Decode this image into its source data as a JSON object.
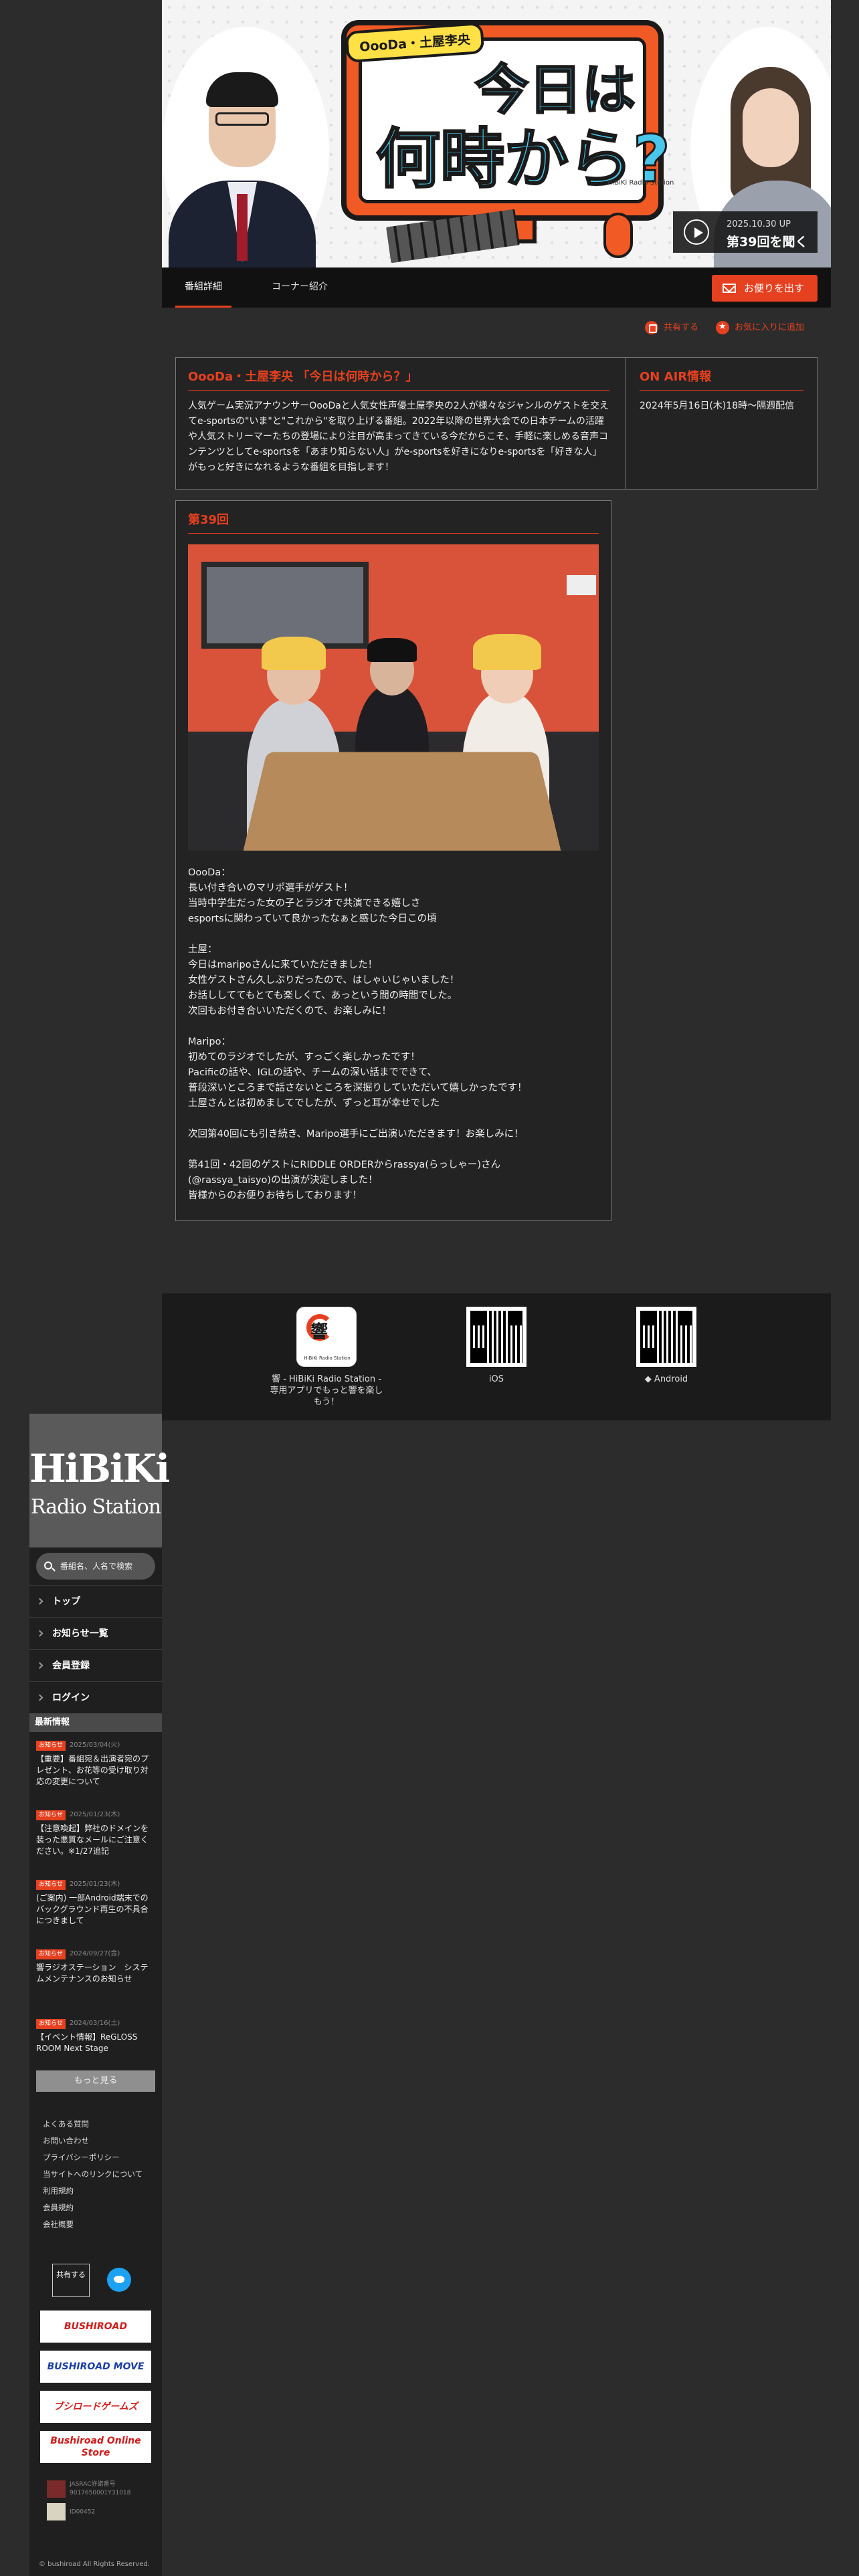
{
  "hero": {
    "logo_tag": "OooDa・土屋李央",
    "title_line1": "今日は",
    "title_line2": "何時から?",
    "brand_small": "HiBiKi Radio Station",
    "play_date": "2025.10.30 UP",
    "play_label": "第39回を聞く"
  },
  "tabs": [
    {
      "label": "番組詳細",
      "active": true
    },
    {
      "label": "コーナー紹介",
      "active": false
    }
  ],
  "letter_button": "お便りを出す",
  "share": {
    "share_label": "共有する",
    "favorite_label": "お気に入りに追加"
  },
  "info": {
    "title": "OooDa・土屋李央 「今日は何時から？」",
    "description": "人気ゲーム実況アナウンサーOooDaと人気女性声優土屋李央の2人が様々なジャンルのゲストを交えてe-sportsの\"いま\"と\"これから\"を取り上げる番組。2022年以降の世界大会での日本チームの活躍や人気ストリーマーたちの登場により注目が高まってきている今だからこそ、手軽に楽しめる音声コンテンツとしてe-sportsを「あまり知らない人」がe-sportsを好きになりe-sportsを「好きな人」がもっと好きになれるような番組を目指します！",
    "onair_title": "ON AIR情報",
    "onair_text": "2024年5月16日(木)18時〜隔週配信"
  },
  "episode": {
    "title": "第39回",
    "body": "OooDa：\n長い付き合いのマリポ選手がゲスト！\n当時中学生だった女の子とラジオで共演できる嬉しさ\nesportsに関わっていて良かったなぁと感じた今日この頃\n\n土屋：\n今日はmaripoさんに来ていただきました！\n女性ゲストさん久しぶりだったので、はしゃいじゃいました！\nお話ししててもとても楽しくて、あっという間の時間でした。\n次回もお付き合いいただくので、お楽しみに！\n\nMaripo：\n初めてのラジオでしたが、すっごく楽しかったです！\nPacificの話や、IGLの話や、チームの深い話までできて、\n普段深いところまで話さないところを深掘りしていただいて嬉しかったです！\n土屋さんとは初めましてでしたが、ずっと耳が幸せでした\n\n次回第40回にも引き続き、Maripo選手にご出演いただきます！お楽しみに！\n\n第41回・42回のゲストにRIDDLE ORDERからrassya(らっしゃー)さん\n(@rassya_taisyo)の出演が決定しました！\n皆様からのお便りお待ちしております！"
  },
  "apps": [
    {
      "caption": "響 - HiBiKi Radio Station - 専用アプリでもっと響を楽しもう！",
      "type": "logo",
      "logo_char": "響",
      "logo_sub": "HiBiKi Radio Station"
    },
    {
      "caption": " iOS",
      "type": "qr"
    },
    {
      "caption": "◆ Android",
      "type": "qr"
    }
  ],
  "sidebar": {
    "brand_line1": "HiBiKi",
    "brand_line2": "Radio Station",
    "search_placeholder": "番組名、人名で検索",
    "nav": [
      "トップ",
      "お知らせ一覧",
      "会員登録",
      "ログイン"
    ],
    "news_heading": "最新情報",
    "news": [
      {
        "badge": "お知らせ",
        "date": "2025/03/04(火)",
        "title": "【重要】番組宛＆出演者宛のプレゼント、お花等の受け取り対応の変更について"
      },
      {
        "badge": "お知らせ",
        "date": "2025/01/23(木)",
        "title": "【注意喚起】弊社のドメインを装った悪質なメールにご注意ください。※1/27追記"
      },
      {
        "badge": "お知らせ",
        "date": "2025/01/23(木)",
        "title": "(ご案内) 一部Android端末でのバックグラウンド再生の不具合につきまして"
      },
      {
        "badge": "お知らせ",
        "date": "2024/09/27(金)",
        "title": "響ラジオステーション　システムメンテナンスのお知らせ"
      },
      {
        "badge": "お知らせ",
        "date": "2024/03/16(土)",
        "title": "【イベント情報】ReGLOSS ROOM Next Stage"
      }
    ],
    "more_label": "もっと見る",
    "links": [
      "よくある質問",
      "お問い合わせ",
      "プライバシーポリシー",
      "当サイトへのリンクについて",
      "利用規約",
      "会員規約",
      "会社概要"
    ],
    "share_label": "共有する",
    "banners": [
      "BUSHIROAD",
      "BUSHIROAD MOVE",
      "ブシロードゲームズ",
      "Bushiroad Online Store"
    ],
    "license1": "JASRAC許諾番号\n9017650001Y31018",
    "license2": "ID00452",
    "copyright": "© bushiroad All Rights Reserved."
  },
  "colors": {
    "accent": "#e5401f",
    "bg": "#2c2c2c",
    "panel": "#232323"
  }
}
